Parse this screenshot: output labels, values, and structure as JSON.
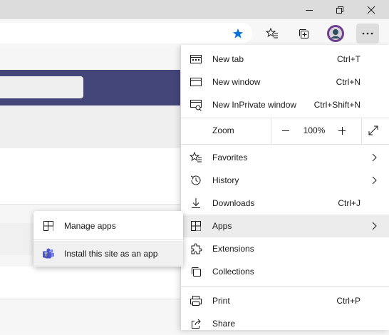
{
  "menu": {
    "new_tab": {
      "label": "New tab",
      "shortcut": "Ctrl+T",
      "icon": "new-tab-icon"
    },
    "new_window": {
      "label": "New window",
      "shortcut": "Ctrl+N",
      "icon": "new-window-icon"
    },
    "new_inprivate": {
      "label": "New InPrivate window",
      "shortcut": "Ctrl+Shift+N",
      "icon": "inprivate-icon"
    },
    "zoom": {
      "label": "Zoom",
      "value": "100%",
      "minus": "−",
      "plus": "+"
    },
    "favorites": {
      "label": "Favorites",
      "icon": "favorites-icon"
    },
    "history": {
      "label": "History",
      "icon": "history-icon"
    },
    "downloads": {
      "label": "Downloads",
      "shortcut": "Ctrl+J",
      "icon": "download-icon"
    },
    "apps": {
      "label": "Apps",
      "icon": "apps-icon"
    },
    "extensions": {
      "label": "Extensions",
      "icon": "extensions-icon"
    },
    "collections": {
      "label": "Collections",
      "icon": "collections-icon"
    },
    "print": {
      "label": "Print",
      "shortcut": "Ctrl+P",
      "icon": "print-icon"
    },
    "share": {
      "label": "Share",
      "icon": "share-icon"
    }
  },
  "apps_submenu": {
    "manage_apps": {
      "label": "Manage apps",
      "icon": "apps-grid-icon"
    },
    "install_site": {
      "label": "Install this site as an app",
      "icon": "teams-icon"
    }
  },
  "colors": {
    "accent_star": "#0b74d9",
    "banner": "#44467a",
    "menu_hover": "#ececec"
  }
}
